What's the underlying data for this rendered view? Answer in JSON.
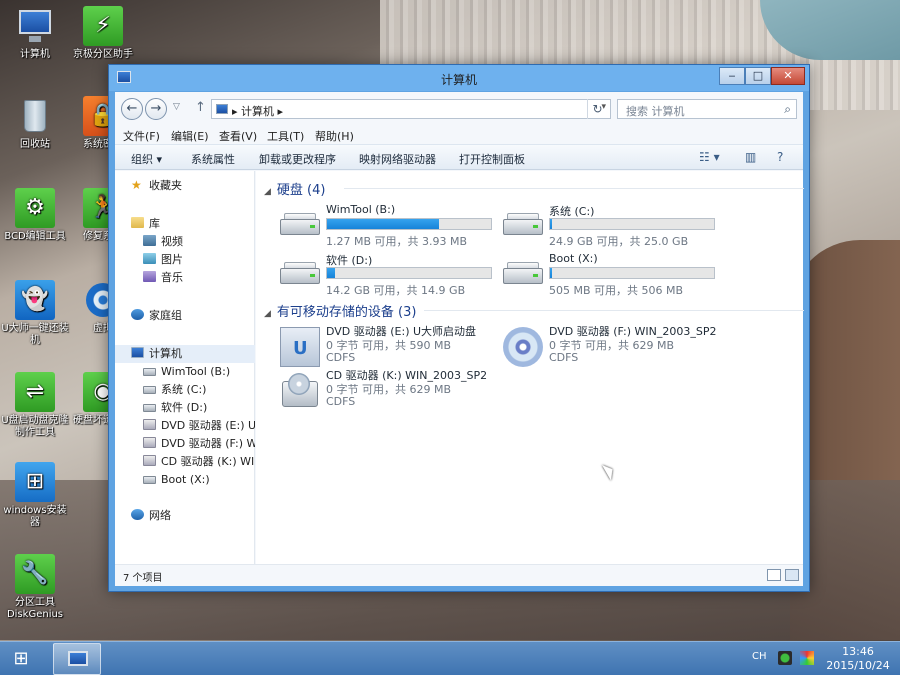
{
  "desktop": {
    "icons": [
      {
        "label": "计算机",
        "icon": "computer-icon"
      },
      {
        "label": "京极分区助手",
        "icon": "partition-assistant-icon"
      },
      {
        "label": "回收站",
        "icon": "recycle-bin-icon"
      },
      {
        "label": "系统密码",
        "icon": "password-tool-icon"
      },
      {
        "label": "BCD编辑工具",
        "icon": "bcd-edit-icon"
      },
      {
        "label": "修复系统",
        "icon": "repair-system-icon"
      },
      {
        "label": "U大师一键还装机",
        "icon": "ghost-install-icon"
      },
      {
        "label": "虚拟",
        "icon": "virtual-drive-icon"
      },
      {
        "label": "U盘启动盘克隆制作工具",
        "icon": "usb-boot-tool-icon"
      },
      {
        "label": "硬盘坏道工具",
        "icon": "disk-bad-sector-icon"
      },
      {
        "label": "windows安装器",
        "icon": "windows-installer-icon"
      },
      {
        "label": "分区工具 DiskGenius",
        "icon": "diskgenius-icon"
      }
    ]
  },
  "window": {
    "title": "计算机",
    "controls": {
      "min": "‒",
      "max": "□",
      "close": "✕"
    },
    "address": {
      "crumb": "计算机",
      "search_placeholder": "搜索 计算机"
    },
    "menu": [
      "文件(F)",
      "编辑(E)",
      "查看(V)",
      "工具(T)",
      "帮助(H)"
    ],
    "toolbar": [
      "组织 ▾",
      "系统属性",
      "卸载或更改程序",
      "映射网络驱动器",
      "打开控制面板"
    ],
    "nav": {
      "favorites": "收藏夹",
      "library": "库",
      "lib_items": [
        "视频",
        "图片",
        "音乐"
      ],
      "homegroup": "家庭组",
      "computer": "计算机",
      "computer_items": [
        "WimTool (B:)",
        "系统 (C:)",
        "软件 (D:)",
        "DVD 驱动器 (E:) U大",
        "DVD 驱动器 (F:) WI",
        "CD 驱动器 (K:) WIN",
        "Boot (X:)"
      ],
      "network": "网络"
    },
    "hard_disks": {
      "header": "硬盘 (4)",
      "drives": [
        {
          "name": "WimTool (B:)",
          "size": "1.27 MB 可用，共 3.93 MB",
          "used_fraction": 0.68
        },
        {
          "name": "系统 (C:)",
          "size": "24.9 GB 可用，共 25.0 GB",
          "used_fraction": 0.004
        },
        {
          "name": "软件 (D:)",
          "size": "14.2 GB 可用，共 14.9 GB",
          "used_fraction": 0.05
        },
        {
          "name": "Boot (X:)",
          "size": "505 MB 可用，共 506 MB",
          "used_fraction": 0.002
        }
      ]
    },
    "removable": {
      "header": "有可移动存储的设备 (3)",
      "devices": [
        {
          "name": "DVD 驱动器 (E:) U大师启动盘",
          "line2": "0 字节 可用，共 590 MB",
          "line3": "CDFS"
        },
        {
          "name": "DVD 驱动器 (F:) WIN_2003_SP2",
          "line2": "0 字节 可用，共 629 MB",
          "line3": "CDFS"
        },
        {
          "name": "CD 驱动器 (K:) WIN_2003_SP2",
          "line2": "0 字节 可用，共 629 MB",
          "line3": "CDFS"
        }
      ]
    },
    "status": {
      "count": "7 个项目"
    }
  },
  "taskbar": {
    "start_icon": "windows-start-icon",
    "lang": "CH",
    "time": "13:46",
    "date": "2015/10/24"
  },
  "colors": {
    "accent": "#1783d9",
    "titlebar": "#6eb1ee",
    "taskbar": "#4a7eba",
    "close": "#c44936"
  }
}
